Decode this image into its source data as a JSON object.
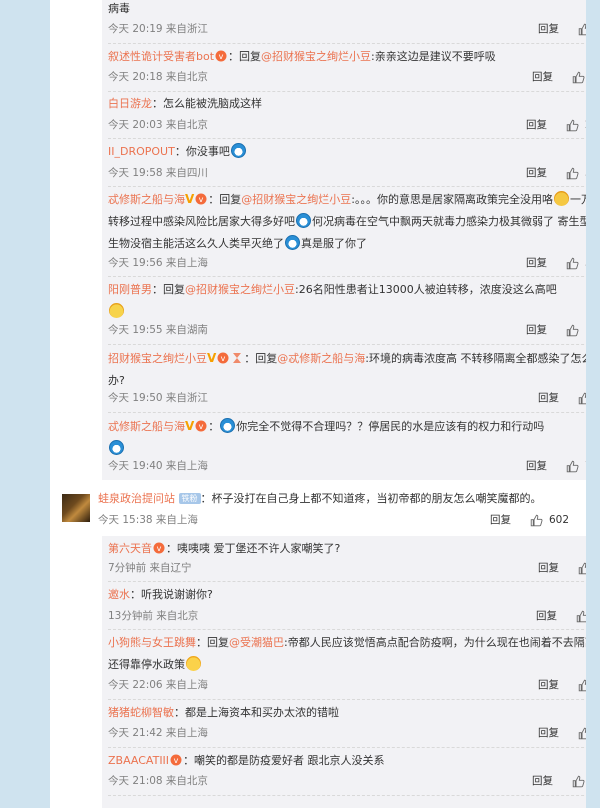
{
  "replies_top": [
    {
      "text": "病毒",
      "meta": "今天 20:19 来自浙江",
      "likes": "2"
    },
    {
      "name": "叙述性诡计受害者bot",
      "prefix": "：回复",
      "mention": "@招财猴宝之绚烂小豆",
      "text": ":亲亲这边是建议不要呼吸",
      "meta": "今天 20:18 来自北京",
      "likes": "65"
    },
    {
      "name": "白日游龙",
      "text": "：怎么能被洗脑成这样",
      "meta": "今天 20:03 来自北京",
      "likes": "212"
    },
    {
      "name": "II_DROPOUT",
      "text": "：你没事吧",
      "meta": "今天 19:58 来自四川",
      "likes": "340"
    },
    {
      "name": "忒修斯之船与海",
      "prefix": "：回复",
      "mention": "@招财猴宝之绚烂小豆",
      "text_parts": [
        ":。。。你的意思是居家隔离政策完全没用咯",
        "一万人转移过程中感染风险比居家大得多好吧",
        "何况病毒在空气中飘两天就毒力感染力极其微弱了 寄生型微生物没宿主能活这么久人类早灭绝了",
        "真是服了你了"
      ],
      "meta": "今天 19:56 来自上海",
      "likes": "302"
    },
    {
      "name": "阳刚普男",
      "prefix": "：回复",
      "mention": "@招财猴宝之绚烂小豆",
      "text": ":26名阳性患者让13000人被迫转移，浓度没这么高吧",
      "meta": "今天 19:55 来自湖南",
      "likes": "165"
    },
    {
      "name": "招财猴宝之绚烂小豆",
      "prefix": "：回复",
      "mention": "@忒修斯之船与海",
      "text": ":环境的病毒浓度高 不转移隔离全都感染了怎么办?",
      "meta": "今天 19:50 来自浙江",
      "likes": "2"
    },
    {
      "name": "忒修斯之船与海",
      "text": "你完全不觉得不合理吗？？停居民的水是应该有的权力和行动吗",
      "meta": "今天 19:40 来自上海",
      "likes": "718"
    }
  ],
  "main": {
    "name": "蛙泉政治提问站",
    "tag": "铁粉",
    "text": "：杯子没打在自己身上都不知道疼，当初帝都的朋友怎么嘲笑魔都的。",
    "meta": "今天 15:38 来自上海",
    "likes": "602"
  },
  "replies_bottom": [
    {
      "name": "第六天音",
      "text": "：咦咦咦 爱丁堡还不许人家嘲笑了?",
      "meta": "7分钟前 来自辽宁",
      "likes": "1"
    },
    {
      "name": "邀水",
      "text": "：听我说谢谢你?",
      "meta": "13分钟前 来自北京",
      "likes": "赞"
    },
    {
      "name": "小狗熊与女王跳舞",
      "prefix": "：回复",
      "mention": "@受潮猫巴",
      "text": ":帝都人民应该觉悟高点配合防疫啊，为什么现在也闹着不去隔离还得靠停水政策",
      "meta": "今天 22:06 来自上海",
      "likes": "8"
    },
    {
      "name": "猪猪蛇柳智敏",
      "text": "：都是上海资本和买办太浓的错啦",
      "meta": "今天 21:42 来自上海",
      "likes": "9"
    },
    {
      "name": "ZBAACATIII",
      "text": "：嘲笑的都是防疫爱好者 跟北京人没关系",
      "meta": "今天 21:08 来自北京",
      "likes": "11"
    }
  ],
  "labels": {
    "reply": "回复"
  }
}
